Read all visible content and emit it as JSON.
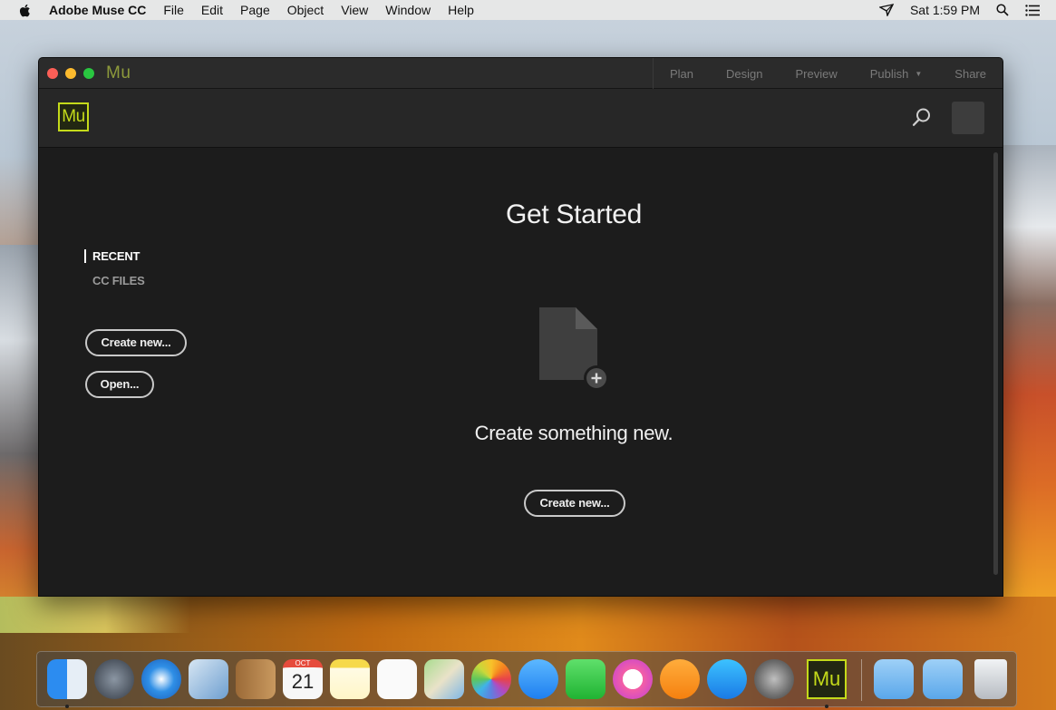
{
  "menubar": {
    "apple_icon": "apple-logo-icon",
    "app_name": "Adobe Muse CC",
    "items": [
      "File",
      "Edit",
      "Page",
      "Object",
      "View",
      "Window",
      "Help"
    ],
    "clock": "Sat 1:59 PM",
    "status_icons": [
      "wifi-icon",
      "spotlight-icon",
      "notification-center-icon"
    ]
  },
  "window": {
    "title": "Mu",
    "modes": [
      "Plan",
      "Design",
      "Preview",
      "Publish",
      "Share"
    ],
    "toolbar": {
      "logo_text": "Mu",
      "search_icon": "search-icon",
      "avatar": "user-avatar"
    },
    "sidebar": {
      "recent_label": "RECENT",
      "cc_files_label": "CC FILES",
      "create_new_label": "Create new...",
      "open_label": "Open..."
    },
    "main": {
      "heading": "Get Started",
      "illustration_icon": "new-document-plus-icon",
      "subheading": "Create something new.",
      "create_new_label": "Create new..."
    }
  },
  "dock": {
    "calendar_month": "OCT",
    "calendar_day": "21",
    "muse_label": "Mu",
    "apps": [
      "finder-icon",
      "launchpad-icon",
      "safari-icon",
      "mail-icon",
      "contacts-icon",
      "calendar-icon",
      "notes-icon",
      "reminders-icon",
      "maps-icon",
      "photos-icon",
      "messages-icon",
      "facetime-icon",
      "itunes-icon",
      "ibooks-icon",
      "app-store-icon",
      "system-preferences-icon",
      "adobe-muse-icon",
      "applications-folder-icon",
      "downloads-folder-icon",
      "trash-icon"
    ]
  },
  "colors": {
    "muse_accent": "#c4da1a",
    "window_bg": "#1c1c1c",
    "toolbar_bg": "#272727",
    "titlebar_bg": "#2b2b2b"
  }
}
